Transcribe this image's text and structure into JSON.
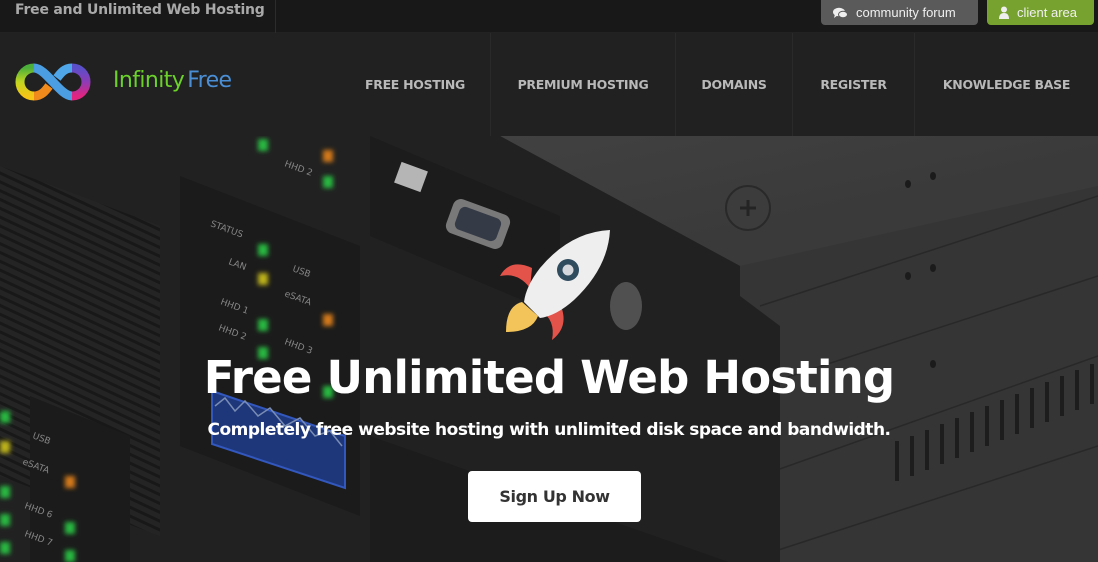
{
  "topbar": {
    "tagline": "Free and Unlimited Web Hosting",
    "community_forum": {
      "label": "community forum",
      "icon": "comments-icon",
      "color": "#5a5a5a"
    },
    "client_area": {
      "label": "client area",
      "icon": "user-icon",
      "color": "#78a22f"
    }
  },
  "brand": {
    "name_part1": "Infinity",
    "name_part2": "Free",
    "color_part1": "#6bd22a",
    "color_part2": "#4a8fd6",
    "logo_icon": "infinity-logo-icon"
  },
  "nav": {
    "items": [
      {
        "label": "FREE HOSTING"
      },
      {
        "label": "PREMIUM HOSTING"
      },
      {
        "label": "DOMAINS"
      },
      {
        "label": "REGISTER"
      },
      {
        "label": "KNOWLEDGE BASE"
      }
    ]
  },
  "hero": {
    "icon": "rocket-icon",
    "title": "Free Unlimited Web Hosting",
    "subtitle": "Completely free website hosting with unlimited disk space and bandwidth.",
    "cta_label": "Sign Up Now",
    "background": "server-rack-illustration",
    "server_labels": [
      "STATUS",
      "LAN",
      "USB",
      "eSATA",
      "HHD 1",
      "HHD 2",
      "HHD 3",
      "USB",
      "eSATA",
      "HHD 6",
      "HHD 7",
      "HHD 2"
    ]
  }
}
